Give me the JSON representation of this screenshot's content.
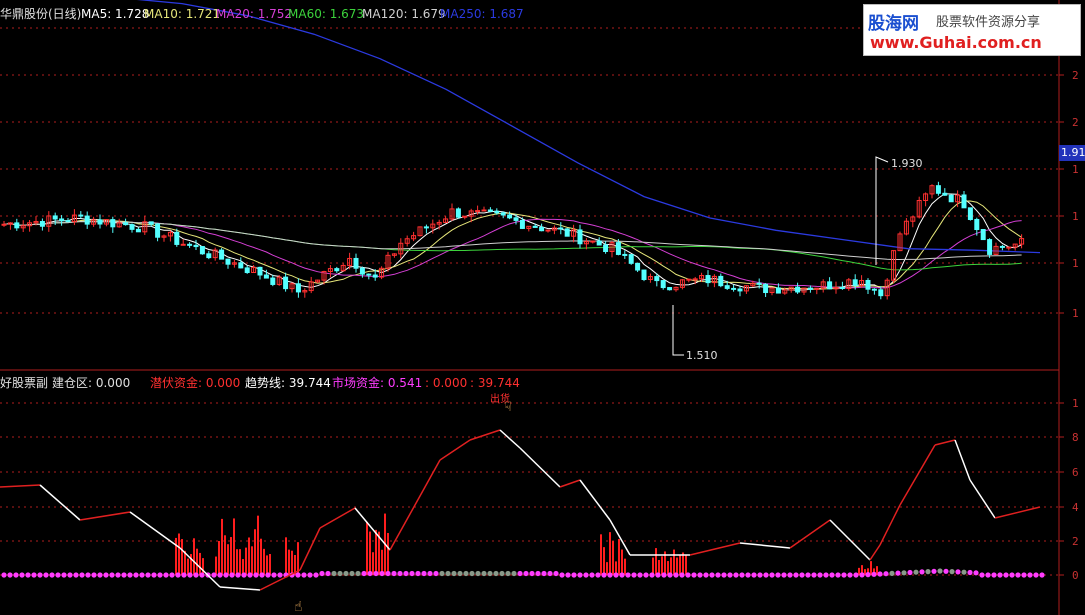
{
  "colors": {
    "background": "#000000",
    "axis": "#b01e1e",
    "candle_up": "#ff3030",
    "candle_down": "#54ffff",
    "ma5": "#ffffff",
    "ma10": "#e6e67a",
    "ma20": "#d43fd4",
    "ma60": "#3cd23c",
    "ma120": "#cfcfcf",
    "ma250": "#2b3ae0",
    "bar_red": "#ff1e1e",
    "dot_magenta": "#ff3cff",
    "dot_gray": "#8a9a8a"
  },
  "main_header": {
    "title": "华鼎股份(日线)",
    "ma5": "MA5: 1.728",
    "ma10": "MA10: 1.721",
    "ma20": "MA20: 1.752",
    "ma60": "MA60: 1.673",
    "ma120": "MA120: 1.679",
    "ma250": "MA250: 1.687"
  },
  "watermark": {
    "logo": "股海网",
    "slogan": "股票软件资源分享",
    "url": "www.Guhai.com.cn"
  },
  "price_tag": "1.91",
  "price_annotations": {
    "high": "1.930",
    "low": "1.510"
  },
  "indicator_header": {
    "name": "好股票副",
    "jiancang": "建仓区: 0.000",
    "qianfu": "潜伏资金: 0.000",
    "qushi": "趋势线: 39.744",
    "shichang": "市场资金: 0.541",
    "extra1": ": 0.000",
    "extra2": ": 39.744"
  },
  "signal_label": "出货",
  "right_axis": {
    "main_ticks": [
      "2",
      "2",
      "2",
      "1",
      "1",
      "1",
      "1"
    ],
    "indicator_ticks": [
      "1",
      "8",
      "6",
      "4",
      "2",
      "0"
    ]
  },
  "chart_data": {
    "type": "candlestick+indicator",
    "ma250_trend": [
      2.53,
      2.52,
      2.5,
      2.46,
      2.4,
      2.32,
      2.22,
      2.1,
      1.98,
      1.87,
      1.8,
      1.76,
      1.73,
      1.7,
      1.695,
      1.687
    ],
    "price_high": 1.93,
    "price_low": 1.51,
    "indicator": {
      "trend_line_last": 39.744,
      "market_funds_last": 0.541,
      "build_zone_last": 0.0,
      "latent_funds_last": 0.0
    }
  }
}
